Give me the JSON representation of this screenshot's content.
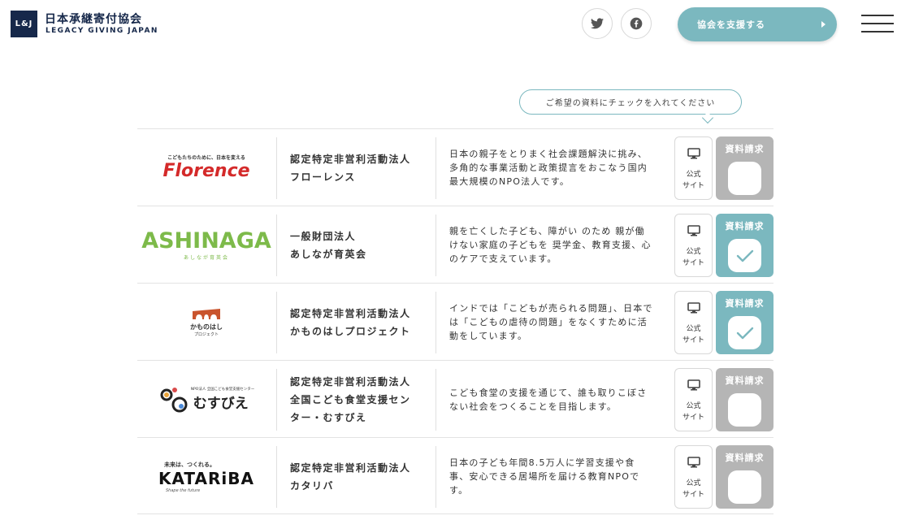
{
  "header": {
    "logo_mark": "L&J",
    "logo_title_ja": "日本承継寄付協会",
    "logo_title_en": "LEGACY GIVING JAPAN",
    "support_label": "協会を支援する",
    "twitter_icon": "twitter-icon",
    "facebook_icon": "facebook-icon",
    "menu_icon": "hamburger-icon"
  },
  "hint": "ご希望の資料にチェックを入れてください",
  "buttons": {
    "site_label_1": "公式",
    "site_label_2": "サイト",
    "request_label": "資料請求"
  },
  "colors": {
    "accent": "#7bb8bf",
    "unchecked": "#b5b5b5",
    "brand_navy": "#16284a"
  },
  "organizations": [
    {
      "logo_tagline": "こどもたちのために、日本を変える",
      "logo_word": "Florence",
      "name_line1": "認定特定非営利活動法人",
      "name_line2": "フローレンス",
      "description": "日本の親子をとりまく社会課題解決に挑み、多角的な事業活動と政策提言をおこなう国内最大規模のNPO法人です。",
      "requested": false
    },
    {
      "logo_word": "ASHINAGA",
      "logo_sub": "あしなが育英会",
      "name_line1": "一般財団法人",
      "name_line2": "あしなが育英会",
      "description": "親を亡くした子ども、障がい のため 親が働けない家庭の子どもを 奨学金、教育支援、心のケアで支えています。",
      "requested": true
    },
    {
      "logo_name": "かものはし",
      "logo_sub": "プロジェクト",
      "name_line1": "認定特定非営利活動法人",
      "name_line2": "かものはしプロジェクト",
      "description": "インドでは「こどもが売られる問題」、日本では「こどもの虐待の問題」をなくすために活動をしています。",
      "requested": true
    },
    {
      "logo_tagline": "NPO法人 全国こども食堂支援センター",
      "logo_word": "むすびえ",
      "name_line1": "認定特定非営利活動法人",
      "name_line2": "全国こども食堂支援セン",
      "name_line3": "ター・むすびえ",
      "description": "こども食堂の支援を通じて、誰も取りこぼさない社会をつくることを目指します。",
      "requested": false
    },
    {
      "logo_tagline": "未来は、つくれる。",
      "logo_word": "KATARiBA",
      "logo_sub": "Shape the future",
      "name_line1": "認定特定非営利活動法人",
      "name_line2": "カタリバ",
      "description": "日本の子ども年間8.5万人に学習支援や食事、安心できる居場所を届ける教育NPOです。",
      "requested": false
    }
  ]
}
